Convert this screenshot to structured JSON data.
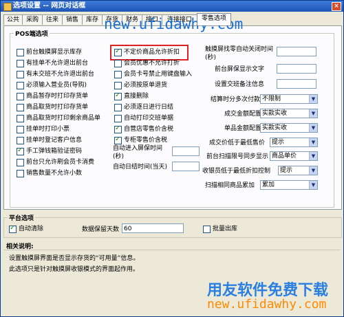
{
  "window": {
    "title": "选项设置 -- 网页对话框",
    "close": "×"
  },
  "tabs": [
    "公共",
    "采购",
    "往来",
    "销售",
    "库存",
    "存货",
    "财务",
    "接口",
    "连接接口",
    "零售选项"
  ],
  "pos": {
    "title": "POS端选项",
    "left": [
      {
        "label": "前台触摸屏显示库存",
        "checked": false
      },
      {
        "label": "有挂单不允许退出前台",
        "checked": false
      },
      {
        "label": "有未交班不允许退出前台",
        "checked": false
      },
      {
        "label": "必须输入营业员(导购)",
        "checked": false
      },
      {
        "label": "商品暂存时打印存货单",
        "checked": false
      },
      {
        "label": "商品取货时打印存货单",
        "checked": false
      },
      {
        "label": "商品取货时打印剩余商品单",
        "checked": false
      },
      {
        "label": "挂单时打印小票",
        "checked": false
      },
      {
        "label": "挂单时登记客户信息",
        "checked": false
      },
      {
        "label": "手工弹钱箱验证密码",
        "checked": true
      },
      {
        "label": "前台只允许刷会员卡消费",
        "checked": false
      },
      {
        "label": "销售数量不允许小数",
        "checked": false
      }
    ],
    "mid": [
      {
        "label": "不定价商品允许折扣",
        "checked": true
      },
      {
        "label": "会员优惠不允许打折",
        "checked": false
      },
      {
        "label": "会员卡号禁止用键盘输入",
        "checked": false
      },
      {
        "label": "必须按原单退货",
        "checked": false
      },
      {
        "label": "直接删除",
        "checked": true
      },
      {
        "label": "必须逐日进行日结",
        "checked": false
      },
      {
        "label": "自动打印交班单据",
        "checked": false
      },
      {
        "label": "自营店零售价含税",
        "checked": true
      },
      {
        "label": "专柜零售价含税",
        "checked": true
      }
    ],
    "auto_lock": {
      "label": "自动进入屏保时间(秒)",
      "value": ""
    },
    "auto_close": {
      "label": "自动日结时间(当天)",
      "value": ""
    },
    "right": [
      {
        "label": "触摸屏找零自动关闭时间(秒)",
        "type": "input",
        "value": ""
      },
      {
        "label": "前台屏保显示文字",
        "type": "input",
        "value": ""
      },
      {
        "label": "设置交班备注信息",
        "type": "input",
        "value": ""
      },
      {
        "label": "结算时分多次付款",
        "type": "select",
        "value": "不限制"
      },
      {
        "label": "成交金额配置",
        "type": "select",
        "value": "实款实收"
      },
      {
        "label": "单品金额配置",
        "type": "select",
        "value": "实款实收"
      },
      {
        "label": "成交价低于最低售价",
        "type": "select",
        "value": "提示"
      },
      {
        "label": "前台扫描限号同步显示",
        "type": "select",
        "value": "商品单价"
      },
      {
        "label": "收银员低于最低折扣控制",
        "type": "select",
        "value": "提示"
      },
      {
        "label": "扫描相同商品累加",
        "type": "select",
        "value": "累加"
      }
    ]
  },
  "platform": {
    "title": "平台选项",
    "auto_clear": {
      "label": "自动清除",
      "checked": true
    },
    "retain_days_label": "数据保留天数",
    "retain_days": "60",
    "batch_out": {
      "label": "批量出库",
      "checked": false
    }
  },
  "desc": {
    "title": "相关说明:",
    "line1": "设置触摸屏界面是否显示存货的“可用量”信息。",
    "line2": "此选项只是针对触摸屏收银模式的界面起作用。"
  },
  "watermark": {
    "url_top": "new.ufidawhy.com",
    "cn": "用友软件免费下载",
    "url_bottom": "new.ufidawhy.com"
  },
  "colors": {
    "title_bar": "#1f55b5",
    "highlight": "#e02020",
    "wm_blue": "#1a6fd6",
    "wm_orange": "#ff8a00"
  }
}
